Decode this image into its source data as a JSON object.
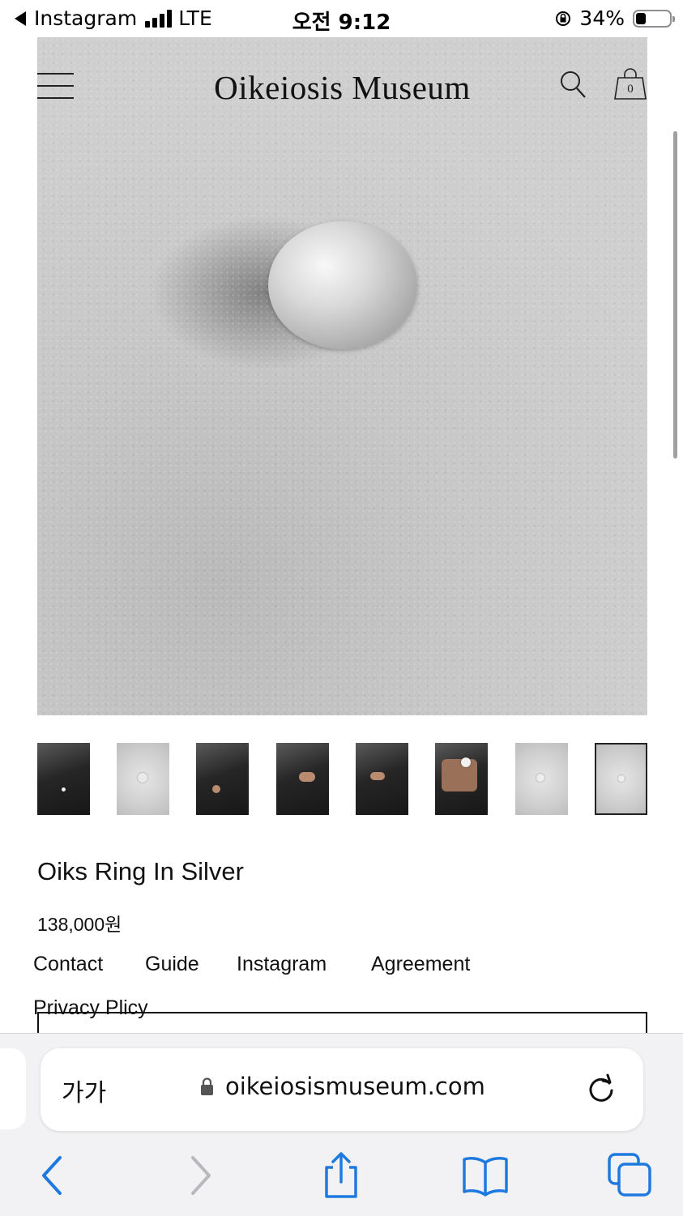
{
  "status_bar": {
    "back_app": "Instagram",
    "network": "LTE",
    "time": "오전 9:12",
    "battery": "34%"
  },
  "site": {
    "title": "Oikeiosis Museum",
    "cart_count": "0"
  },
  "thumbnails": [
    {
      "alt": "model in black coat",
      "style": "dark"
    },
    {
      "alt": "ring on stone",
      "style": "light"
    },
    {
      "alt": "model holding coat",
      "style": "dark"
    },
    {
      "alt": "hand with ring",
      "style": "dark"
    },
    {
      "alt": "model in leather coat",
      "style": "dark"
    },
    {
      "alt": "hand close-up with ring",
      "style": "dark"
    },
    {
      "alt": "ring on stone, side",
      "style": "light"
    },
    {
      "alt": "ring on stone, top",
      "style": "light",
      "selected": true
    }
  ],
  "product": {
    "name": "Oiks Ring In Silver",
    "price": "138,000원"
  },
  "footer_links": [
    "Contact",
    "Guide",
    "Instagram",
    "Agreement"
  ],
  "privacy_link": "Privacy Plicy",
  "safari": {
    "aa_label": "가가",
    "url": "oikeiosismuseum.com"
  },
  "colors": {
    "accent": "#1f7ae0",
    "disabled": "#b9b9bd"
  }
}
